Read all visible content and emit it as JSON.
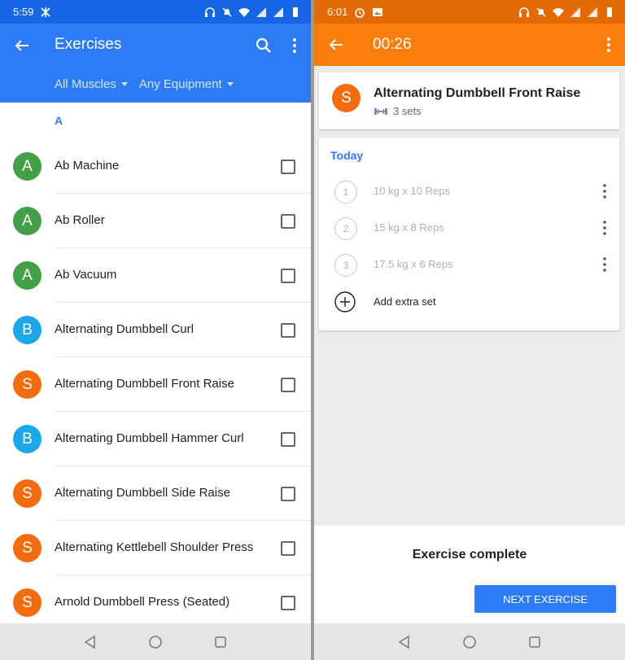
{
  "left": {
    "status": {
      "time": "5:59"
    },
    "appbar": {
      "title": "Exercises"
    },
    "filters": {
      "muscles": "All Muscles",
      "equipment": "Any Equipment"
    },
    "section": "A",
    "exercises": [
      {
        "letter": "A",
        "name": "Ab Machine",
        "color": "#43a047"
      },
      {
        "letter": "A",
        "name": "Ab Roller",
        "color": "#43a047"
      },
      {
        "letter": "A",
        "name": "Ab Vacuum",
        "color": "#43a047"
      },
      {
        "letter": "B",
        "name": "Alternating Dumbbell Curl",
        "color": "#1ea7e8"
      },
      {
        "letter": "S",
        "name": "Alternating Dumbbell Front Raise",
        "color": "#f46c10"
      },
      {
        "letter": "B",
        "name": "Alternating Dumbbell Hammer Curl",
        "color": "#1ea7e8"
      },
      {
        "letter": "S",
        "name": "Alternating Dumbbell Side Raise",
        "color": "#f46c10"
      },
      {
        "letter": "S",
        "name": "Alternating Kettlebell Shoulder Press",
        "color": "#f46c10"
      },
      {
        "letter": "S",
        "name": "Arnold Dumbbell Press (Seated)",
        "color": "#f46c10"
      }
    ]
  },
  "right": {
    "status": {
      "time": "6:01"
    },
    "appbar": {
      "timer": "00:26"
    },
    "exercise": {
      "letter": "S",
      "name": "Alternating Dumbbell Front Raise",
      "sets_label": "3 sets"
    },
    "today_label": "Today",
    "sets": [
      {
        "num": "1",
        "text": "10 kg x 10 Reps"
      },
      {
        "num": "2",
        "text": "15 kg x 8 Reps"
      },
      {
        "num": "3",
        "text": "17.5 kg x 6 Reps"
      }
    ],
    "add_set_label": "Add extra set",
    "complete_label": "Exercise complete",
    "next_button": "NEXT EXERCISE"
  },
  "colors": {
    "blue": "#2d7cf6",
    "orange": "#fb7d0b",
    "green": "#43a047",
    "light_blue": "#1ea7e8"
  }
}
